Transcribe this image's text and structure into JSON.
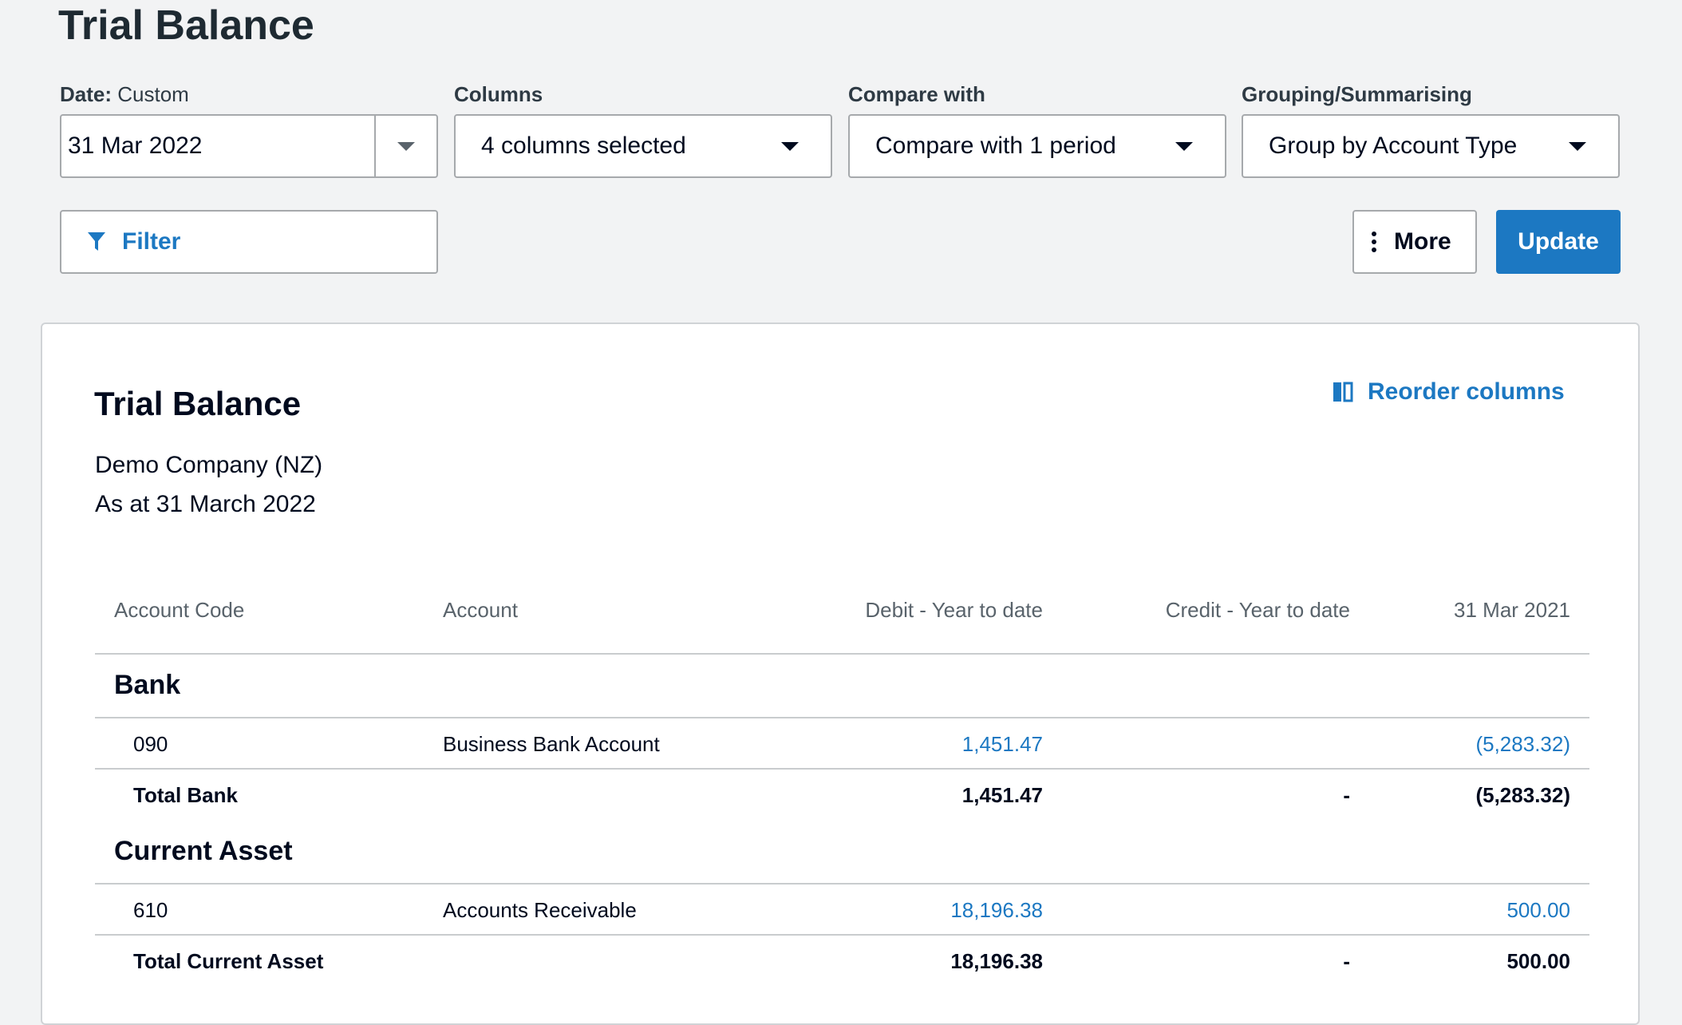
{
  "page": {
    "title": "Trial Balance"
  },
  "controls": {
    "date": {
      "label": "Date:",
      "mode": "Custom",
      "value": "31 Mar 2022"
    },
    "columns": {
      "label": "Columns",
      "value": "4 columns selected"
    },
    "compare": {
      "label": "Compare with",
      "value": "Compare with 1 period"
    },
    "grouping": {
      "label": "Grouping/Summarising",
      "value": "Group by Account Type"
    },
    "filter_label": "Filter",
    "more_label": "More",
    "update_label": "Update"
  },
  "report": {
    "title": "Trial Balance",
    "reorder_label": "Reorder columns",
    "company": "Demo Company (NZ)",
    "as_at": "As at 31 March 2022",
    "headers": {
      "code": "Account Code",
      "account": "Account",
      "debit": "Debit - Year to date",
      "credit": "Credit - Year to date",
      "prior": "31 Mar 2021"
    },
    "groups": [
      {
        "name": "Bank",
        "rows": [
          {
            "code": "090",
            "account": "Business Bank Account",
            "debit": "1,451.47",
            "credit": "",
            "prior": "(5,283.32)"
          }
        ],
        "total": {
          "label": "Total Bank",
          "debit": "1,451.47",
          "credit": "-",
          "prior": "(5,283.32)"
        }
      },
      {
        "name": "Current Asset",
        "rows": [
          {
            "code": "610",
            "account": "Accounts Receivable",
            "debit": "18,196.38",
            "credit": "",
            "prior": "500.00"
          }
        ],
        "total": {
          "label": "Total Current Asset",
          "debit": "18,196.38",
          "credit": "-",
          "prior": "500.00"
        }
      }
    ]
  },
  "colors": {
    "accent": "#1c78c2",
    "text": "#000a1e",
    "border": "#a6a9ac"
  }
}
